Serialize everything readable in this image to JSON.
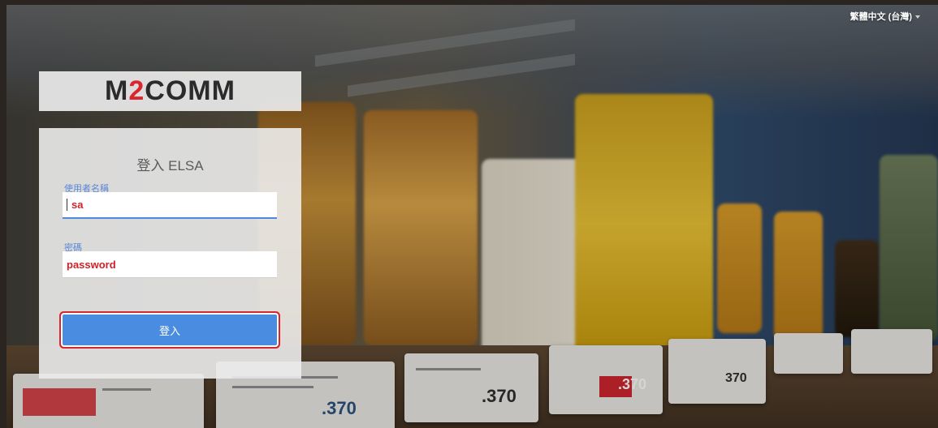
{
  "language_selector": {
    "label": "繁體中文 (台灣)"
  },
  "logo": {
    "prefix": "M",
    "two": "2",
    "suffix": "COMM"
  },
  "login": {
    "title": "登入 ELSA",
    "username_label": "使用者名稱",
    "username_value": "sa",
    "password_label": "密碼",
    "password_value": "password",
    "submit_label": "登入"
  },
  "background": {
    "prices": [
      ".370",
      ".370",
      ".370",
      "370"
    ],
    "colors": {
      "accent_blue": "#4a8de0",
      "highlight_red": "#d9262e",
      "logo_red": "#d9272e"
    }
  }
}
